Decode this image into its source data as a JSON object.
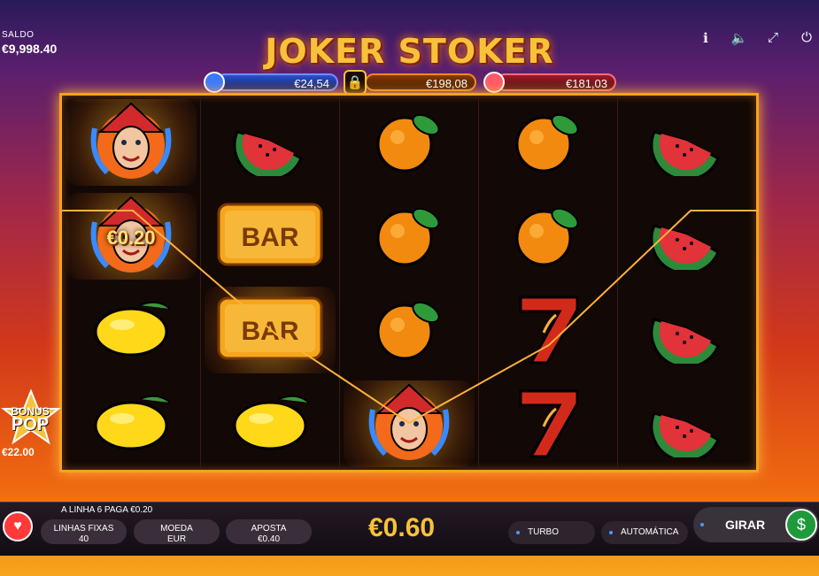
{
  "balance": {
    "label": "SALDO",
    "value": "€9,998.40"
  },
  "top_icons": [
    "info-icon",
    "sound-icon",
    "fullscreen-icon",
    "power-icon"
  ],
  "title": "JOKER STOKER",
  "jackpots": {
    "blue": "€24,54",
    "orange": "€198,08",
    "red": "€181,03"
  },
  "reels": [
    [
      {
        "symbol": "joker",
        "win": true
      },
      {
        "symbol": "joker",
        "win": true,
        "label": "€0.20"
      },
      {
        "symbol": "lemon",
        "win": false
      },
      {
        "symbol": "lemon",
        "win": false
      }
    ],
    [
      {
        "symbol": "watermelon",
        "win": false
      },
      {
        "symbol": "bar",
        "win": false
      },
      {
        "symbol": "bar",
        "win": true
      },
      {
        "symbol": "lemon",
        "win": false
      }
    ],
    [
      {
        "symbol": "orange",
        "win": false
      },
      {
        "symbol": "orange",
        "win": false
      },
      {
        "symbol": "orange",
        "win": false
      },
      {
        "symbol": "joker",
        "win": true
      }
    ],
    [
      {
        "symbol": "orange",
        "win": false
      },
      {
        "symbol": "orange",
        "win": false
      },
      {
        "symbol": "seven",
        "win": false
      },
      {
        "symbol": "seven",
        "win": false
      }
    ],
    [
      {
        "symbol": "watermelon",
        "win": false
      },
      {
        "symbol": "watermelon",
        "win": false
      },
      {
        "symbol": "watermelon",
        "win": false
      },
      {
        "symbol": "watermelon",
        "win": false
      }
    ]
  ],
  "symbol_text": {
    "bar": "BAR"
  },
  "bonus_pop": {
    "line1": "BONUS",
    "line2": "POP",
    "amount": "€22.00"
  },
  "controls": {
    "line_message": "A LINHA 6 PAGA €0.20",
    "lines": {
      "label": "LINHAS FIXAS",
      "value": "40"
    },
    "coin": {
      "label": "MOEDA",
      "value": "EUR"
    },
    "bet": {
      "label": "APOSTA",
      "value": "€0.40"
    },
    "total_bet": "€0.60",
    "turbo": "TURBO",
    "auto": "AUTOMÁTICA",
    "spin": "GIRAR"
  },
  "colors": {
    "gold": "#f6c23a",
    "frame": "#f6a21c",
    "spin_green": "#1e9a3a"
  }
}
